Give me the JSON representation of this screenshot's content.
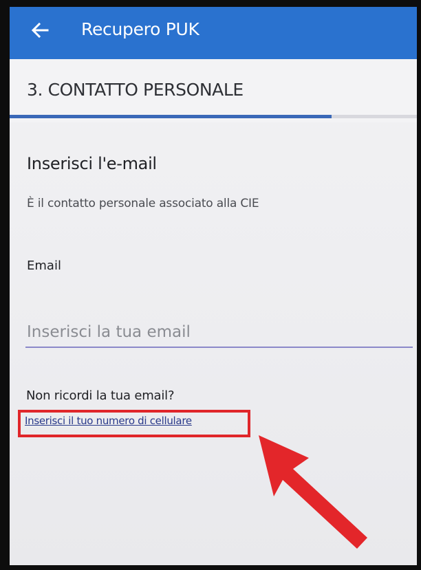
{
  "app_bar": {
    "title": "Recupero PUK",
    "background_color": "#2a72cf",
    "back_icon": "arrow-left-icon"
  },
  "step": {
    "title": "3. CONTATTO PERSONALE",
    "progress_fraction": 0.79,
    "progress_color": "#3a68b8"
  },
  "form": {
    "title": "Inserisci l'e-mail",
    "subtitle": "È il contatto personale associato alla CIE",
    "email_label": "Email",
    "email_placeholder": "Inserisci la tua email",
    "email_value": ""
  },
  "help": {
    "question": "Non ricordi la tua email?",
    "phone_link": "Inserisci il tuo numero di cellulare"
  },
  "annotation": {
    "highlight_color": "#e0262a",
    "arrow_icon": "red-pointer-arrow"
  }
}
